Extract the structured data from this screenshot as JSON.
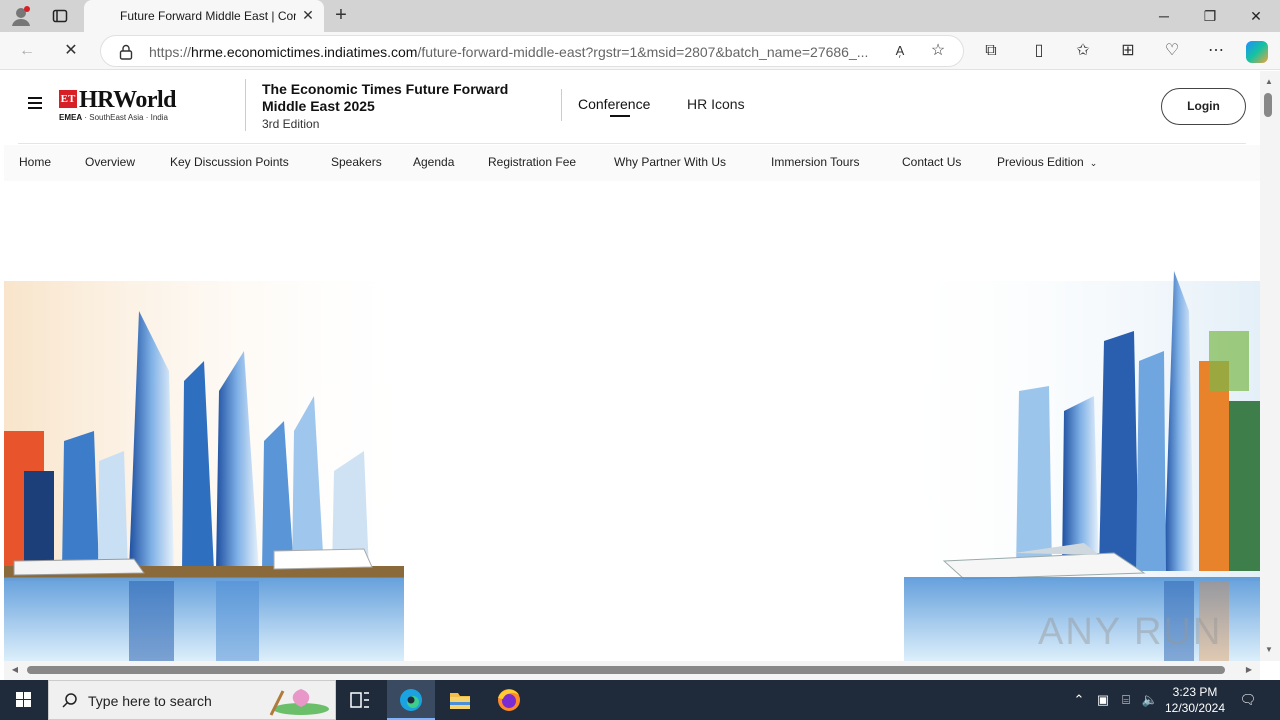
{
  "browser": {
    "tab_title": "Future Forward Middle East | Cor",
    "url_scheme": "https://",
    "url_domain": "hrme.economictimes.indiatimes.com",
    "url_path": "/future-forward-middle-east?rgstr=1&msid=2807&batch_name=27686_..."
  },
  "site": {
    "logo_badge": "ET",
    "logo_brand": "HRWorld",
    "logo_regions_bold": "EMEA",
    "logo_regions": " · SouthEast Asia · India",
    "event_title": "The Economic Times Future Forward Middle East 2025",
    "event_edition": "3rd Edition",
    "top_nav": {
      "conference": "Conference",
      "hr_icons": "HR Icons"
    },
    "login_label": "Login"
  },
  "subnav": [
    "Home",
    "Overview",
    "Key Discussion Points",
    "Speakers",
    "Agenda",
    "Registration Fee",
    "Why Partner With Us",
    "Immersion Tours",
    "Contact Us",
    "Previous Edition"
  ],
  "hero": {
    "watermark": "ANY RUN"
  },
  "taskbar": {
    "search_placeholder": "Type here to search",
    "time": "3:23 PM",
    "date": "12/30/2024"
  }
}
